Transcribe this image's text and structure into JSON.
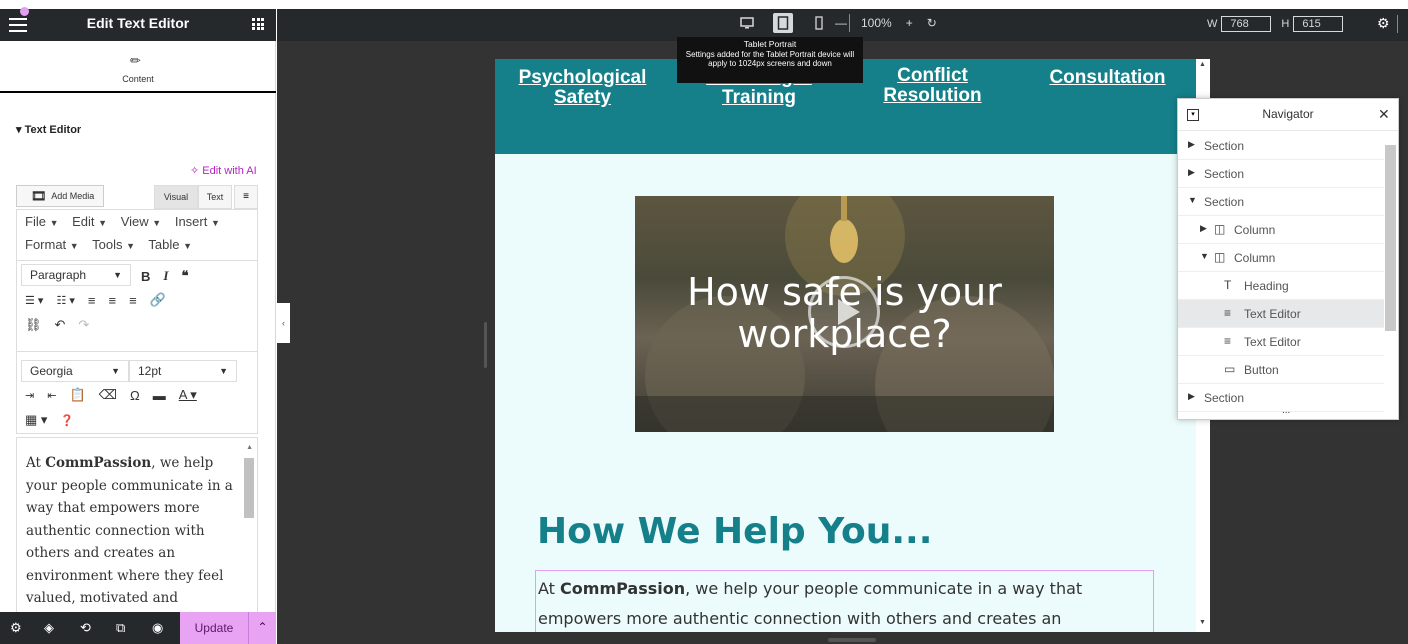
{
  "editor_panel": {
    "title": "Edit Text Editor",
    "tab_content": "Content",
    "section_title": "Text Editor",
    "edit_with_ai": "Edit with AI",
    "add_media": "Add Media",
    "tab_visual": "Visual",
    "tab_text": "Text",
    "menus": {
      "file": "File",
      "edit": "Edit",
      "view": "View",
      "insert": "Insert",
      "format": "Format",
      "tools": "Tools",
      "table": "Table"
    },
    "paragraph_select": "Paragraph",
    "font_family_select": "Georgia",
    "font_size_select": "12pt",
    "content": {
      "prefix": "At ",
      "brand": "CommPassion",
      "rest": ", we help your people communicate in a way that empowers more authentic connection with others and creates an environment where they feel valued, motivated and psychologically safe to..."
    },
    "update_button": "Update"
  },
  "topbar": {
    "zoom": "100%",
    "width_label": "W",
    "width_value": "768",
    "height_label": "H",
    "height_value": "615",
    "tooltip_title": "Tablet Portrait",
    "tooltip_body": "Settings added for the Tablet Portrait device will apply to 1024px screens and down"
  },
  "page": {
    "nav_links": [
      "Psychological Safety",
      "Coaching & Training",
      "Conflict Resolution",
      "Consultation"
    ],
    "hero_title": "How safe is your workplace?",
    "heading": "How We Help You...",
    "text_prefix": "At ",
    "text_brand": "CommPassion",
    "text_rest": ", we help your people communicate in a way that empowers more authentic connection with others and creates an"
  },
  "navigator": {
    "title": "Navigator",
    "items": [
      {
        "label": "Section",
        "icon": "caret-right-icon"
      },
      {
        "label": "Section",
        "icon": "caret-right-icon"
      },
      {
        "label": "Section",
        "icon": "caret-down-icon"
      },
      {
        "label": "Column",
        "icon": "column-icon"
      },
      {
        "label": "Column",
        "icon": "column-icon"
      },
      {
        "label": "Heading",
        "icon": "heading-icon"
      },
      {
        "label": "Text Editor",
        "icon": "text-editor-icon"
      },
      {
        "label": "Text Editor",
        "icon": "text-editor-icon"
      },
      {
        "label": "Button",
        "icon": "button-icon"
      },
      {
        "label": "Section",
        "icon": "caret-right-icon"
      }
    ],
    "more": "..."
  },
  "colors": {
    "accent": "#e8a3f2",
    "brand_teal": "#15808a",
    "page_bg": "#ecfbfb",
    "panel_dark": "#26292c"
  }
}
